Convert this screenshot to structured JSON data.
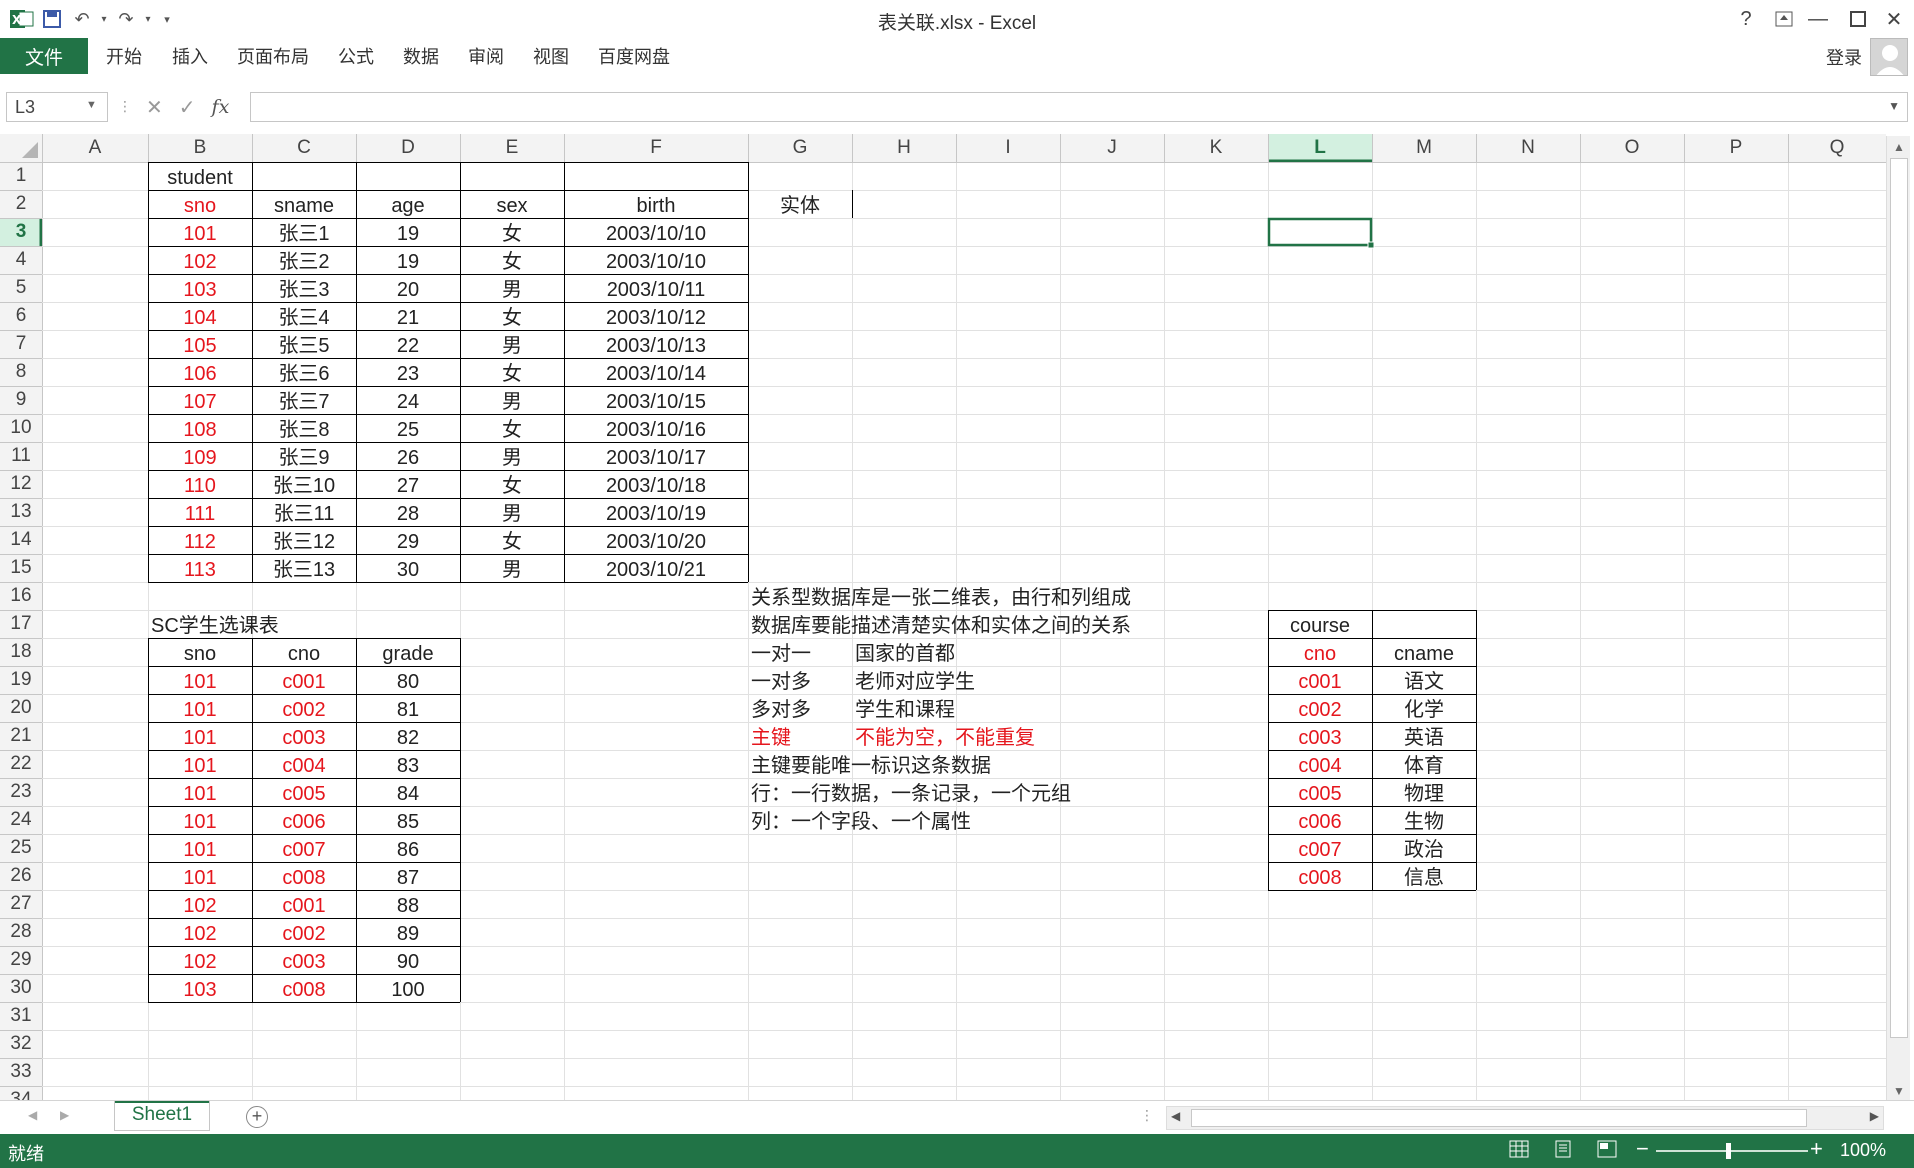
{
  "app": {
    "title": "表关联.xlsx - Excel",
    "help": "?",
    "login": "登录"
  },
  "ribbon": {
    "file": "文件",
    "tabs": [
      "开始",
      "插入",
      "页面布局",
      "公式",
      "数据",
      "审阅",
      "视图",
      "百度网盘"
    ]
  },
  "formula_bar": {
    "name_box": "L3",
    "fx": "fx",
    "formula": ""
  },
  "grid": {
    "columns": [
      "A",
      "B",
      "C",
      "D",
      "E",
      "F",
      "G",
      "H",
      "I",
      "J",
      "K",
      "L",
      "M",
      "N",
      "O",
      "P",
      "Q"
    ],
    "rows": [
      "1",
      "2",
      "3",
      "4",
      "5",
      "6",
      "7",
      "8",
      "9",
      "10",
      "11",
      "12",
      "13",
      "14",
      "15",
      "16",
      "17",
      "18",
      "19",
      "20",
      "21",
      "22",
      "23",
      "24",
      "25",
      "26",
      "27",
      "28",
      "29",
      "30",
      "31",
      "32",
      "33",
      "34"
    ],
    "selected_column": "L",
    "selected_row": "3",
    "student": {
      "title": "student",
      "headers": [
        "sno",
        "sname",
        "age",
        "sex",
        "birth"
      ],
      "rows": [
        [
          "101",
          "张三1",
          "19",
          "女",
          "2003/10/10"
        ],
        [
          "102",
          "张三2",
          "19",
          "女",
          "2003/10/10"
        ],
        [
          "103",
          "张三3",
          "20",
          "男",
          "2003/10/11"
        ],
        [
          "104",
          "张三4",
          "21",
          "女",
          "2003/10/12"
        ],
        [
          "105",
          "张三5",
          "22",
          "男",
          "2003/10/13"
        ],
        [
          "106",
          "张三6",
          "23",
          "女",
          "2003/10/14"
        ],
        [
          "107",
          "张三7",
          "24",
          "男",
          "2003/10/15"
        ],
        [
          "108",
          "张三8",
          "25",
          "女",
          "2003/10/16"
        ],
        [
          "109",
          "张三9",
          "26",
          "男",
          "2003/10/17"
        ],
        [
          "110",
          "张三10",
          "27",
          "女",
          "2003/10/18"
        ],
        [
          "111",
          "张三11",
          "28",
          "男",
          "2003/10/19"
        ],
        [
          "112",
          "张三12",
          "29",
          "女",
          "2003/10/20"
        ],
        [
          "113",
          "张三13",
          "30",
          "男",
          "2003/10/21"
        ]
      ]
    },
    "entity_label": "实体",
    "sc": {
      "title": "SC学生选课表",
      "headers": [
        "sno",
        "cno",
        "grade"
      ],
      "rows": [
        [
          "101",
          "c001",
          "80"
        ],
        [
          "101",
          "c002",
          "81"
        ],
        [
          "101",
          "c003",
          "82"
        ],
        [
          "101",
          "c004",
          "83"
        ],
        [
          "101",
          "c005",
          "84"
        ],
        [
          "101",
          "c006",
          "85"
        ],
        [
          "101",
          "c007",
          "86"
        ],
        [
          "101",
          "c008",
          "87"
        ],
        [
          "102",
          "c001",
          "88"
        ],
        [
          "102",
          "c002",
          "89"
        ],
        [
          "102",
          "c003",
          "90"
        ],
        [
          "103",
          "c008",
          "100"
        ]
      ]
    },
    "notes": {
      "line1": "关系型数据库是一张二维表，由行和列组成",
      "line2": "数据库要能描述清楚实体和实体之间的关系",
      "pairs": [
        [
          "一对一",
          "国家的首都"
        ],
        [
          "一对多",
          "老师对应学生"
        ],
        [
          "多对多",
          "学生和课程"
        ],
        [
          "主键",
          "不能为空，不能重复"
        ]
      ],
      "line7": "主键要能唯一标识这条数据",
      "line8": "行：一行数据，一条记录，一个元组",
      "line9": "列：一个字段、一个属性"
    },
    "course": {
      "title": "course",
      "headers": [
        "cno",
        "cname"
      ],
      "rows": [
        [
          "c001",
          "语文"
        ],
        [
          "c002",
          "化学"
        ],
        [
          "c003",
          "英语"
        ],
        [
          "c004",
          "体育"
        ],
        [
          "c005",
          "物理"
        ],
        [
          "c006",
          "生物"
        ],
        [
          "c007",
          "政治"
        ],
        [
          "c008",
          "信息"
        ]
      ]
    }
  },
  "sheets": {
    "active": "Sheet1"
  },
  "status": {
    "text": "就绪",
    "zoom": "100%"
  },
  "colors": {
    "accent": "#217346",
    "key_red": "#e5161d",
    "gridline": "#e1e1e1"
  }
}
